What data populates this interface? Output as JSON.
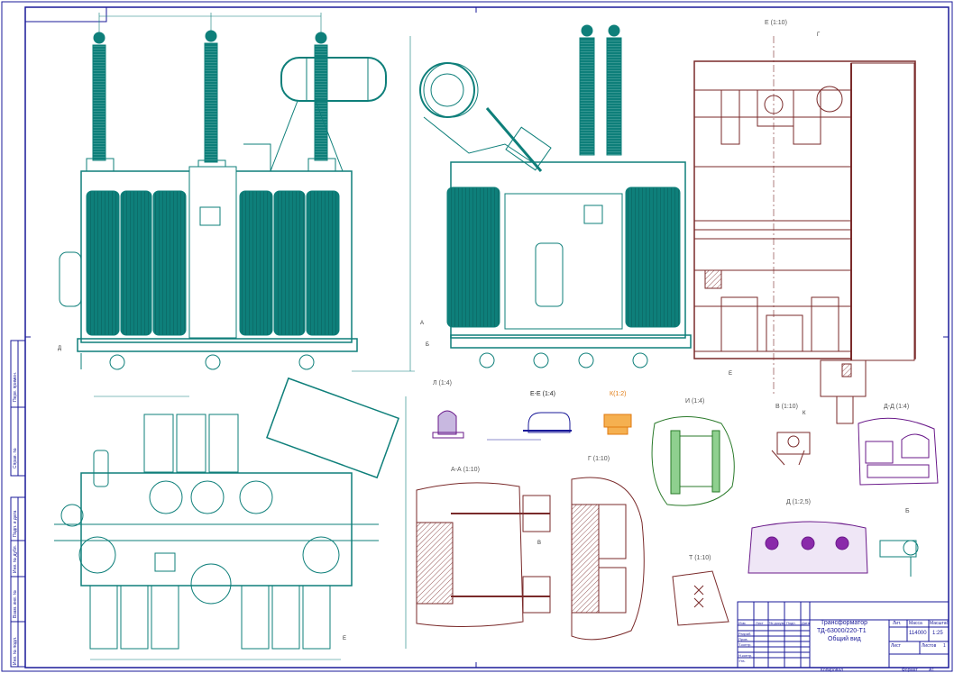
{
  "drawing": {
    "views": {
      "section_e": "Е (1:10)",
      "view_l": "Л (1:4)",
      "section_ee": "Е-Е (1:4)",
      "view_k": "К(1:2)",
      "view_i": "И (1:4)",
      "view_v": "В (1:10)",
      "section_dd": "Д-Д (1:4)",
      "section_aa": "А-А (1:10)",
      "view_g": "Г (1:10)",
      "view_d": "Д (1:2,5)",
      "view_t": "Т (1:10)",
      "view_b": "Б"
    },
    "title_block": {
      "title_line1": "Трансформатор",
      "title_line2": "ТД-63000/220-Т1",
      "title_line3": "Общий вид",
      "header_lit": "Лит.",
      "header_mass": "Масса",
      "header_scale": "Масштаб",
      "mass": "114000",
      "scale": "1:25",
      "sheet_label": "Лист",
      "sheets_label": "Листов",
      "sheets_value": "1",
      "col_izm": "Изм.",
      "col_list": "Лист",
      "col_doc": "№ докум.",
      "col_sign": "Подп.",
      "col_date": "Дата",
      "role_dev": "Разраб.",
      "role_check": "Пров.",
      "role_tcontr": "Т.контр.",
      "role_ncontr": "Н.контр.",
      "role_approve": "Утв.",
      "copied": "Копировал",
      "format_label": "Формат",
      "format_value": "А1"
    },
    "side_stamp": {
      "perv_primen": "Перв. примен.",
      "sprav": "Справ. №",
      "podp_data": "Подп. и дата",
      "inv_dubl": "Инв. № дубл.",
      "vzam_inv": "Взам. инв. №",
      "inv_podl": "Инв. № подл."
    },
    "marks": {
      "a": "А",
      "b": "Б",
      "g": "Г",
      "d": "Д",
      "k": "К",
      "v": "В",
      "e": "Е",
      "ee": "Е"
    },
    "colors": {
      "frame": "#1a1a99",
      "teal": "#0e7f7a",
      "brown": "#7a2a2a",
      "purple": "#6a1a8a",
      "green": "#2a7a2a",
      "orange": "#e07a10"
    }
  }
}
